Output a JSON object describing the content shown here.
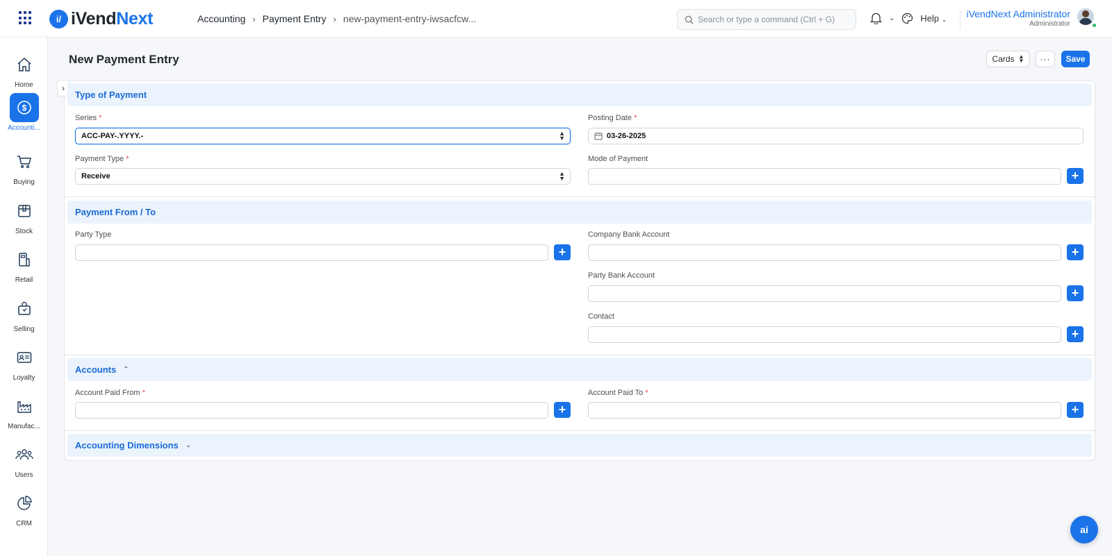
{
  "navbar": {
    "logo_a": "iVend",
    "logo_b": "Next",
    "breadcrumb": [
      "Accounting",
      "Payment Entry",
      "new-payment-entry-iwsacfcw..."
    ],
    "search_placeholder": "Search or type a command (Ctrl + G)",
    "help_label": "Help",
    "user_name": "iVendNext Administrator",
    "user_role": "Administrator"
  },
  "sidebar": {
    "items": [
      {
        "label": "Home",
        "icon": "home-icon"
      },
      {
        "label": "Accounti...",
        "icon": "dollar-icon"
      },
      {
        "label": "Buying",
        "icon": "cart-icon"
      },
      {
        "label": "Stock",
        "icon": "box-icon"
      },
      {
        "label": "Retail",
        "icon": "pos-icon"
      },
      {
        "label": "Selling",
        "icon": "bag-icon"
      },
      {
        "label": "Loyalty",
        "icon": "id-card-icon"
      },
      {
        "label": "Manufac...",
        "icon": "factory-icon"
      },
      {
        "label": "Users",
        "icon": "users-icon"
      },
      {
        "label": "CRM",
        "icon": "pie-chart-icon"
      }
    ]
  },
  "page": {
    "title": "New Payment Entry",
    "cards_label": "Cards",
    "more_label": "···",
    "save_label": "Save"
  },
  "form": {
    "type_of_payment": {
      "title": "Type of Payment",
      "series_label": "Series",
      "series_value": "ACC-PAY-.YYYY.-",
      "posting_date_label": "Posting Date",
      "posting_date_value": "03-26-2025",
      "payment_type_label": "Payment Type",
      "payment_type_value": "Receive",
      "mode_of_payment_label": "Mode of Payment"
    },
    "payment_from_to": {
      "title": "Payment From / To",
      "party_type_label": "Party Type",
      "company_bank_account_label": "Company Bank Account",
      "party_bank_account_label": "Party Bank Account",
      "contact_label": "Contact"
    },
    "accounts": {
      "title": "Accounts",
      "paid_from_label": "Account Paid From",
      "paid_to_label": "Account Paid To"
    },
    "accounting_dimensions": {
      "title": "Accounting Dimensions"
    },
    "required_mark": "*"
  },
  "ai_button": "ai"
}
